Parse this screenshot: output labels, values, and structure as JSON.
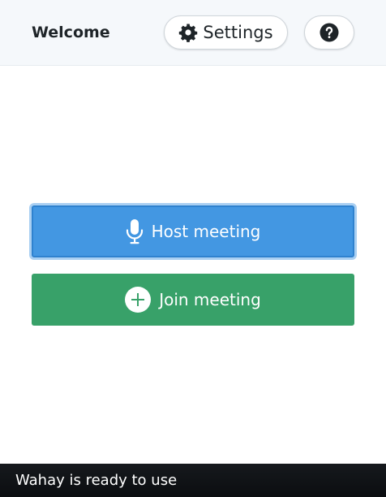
{
  "header": {
    "title": "Welcome",
    "settings_label": "Settings",
    "help_icon": "question-circle-icon",
    "settings_icon": "gear-icon"
  },
  "main": {
    "host_label": "Host meeting",
    "host_icon": "microphone-icon",
    "join_label": "Join meeting",
    "join_icon": "plus-circle-icon"
  },
  "status": {
    "text": "Wahay is ready to use"
  },
  "colors": {
    "host_button": "#4397e2",
    "join_button": "#38a169",
    "status_bar": "#111417",
    "header_bg": "#f5f8fb"
  }
}
